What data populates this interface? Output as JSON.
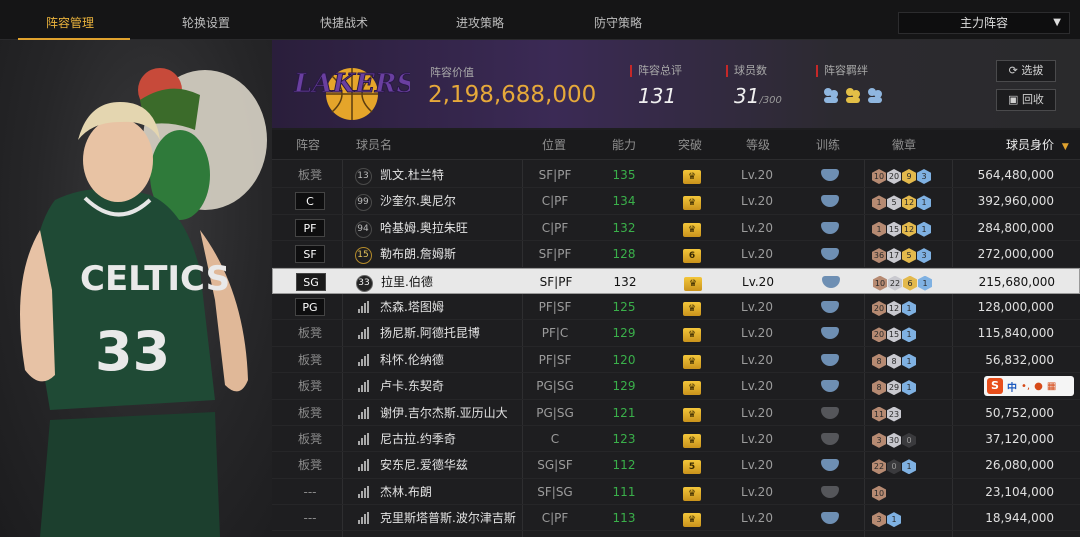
{
  "nav": {
    "tabs": [
      "阵容管理",
      "轮换设置",
      "快捷战术",
      "进攻策略",
      "防守策略"
    ],
    "active": 0,
    "lineup_select": "主力阵容"
  },
  "header": {
    "team_logo_text": "LAKERS",
    "value_label": "阵容价值",
    "value": "2,198,688,000",
    "rating_label": "阵容总评",
    "rating": "131",
    "count_label": "球员数",
    "count": "31",
    "count_max": "/300",
    "bond_label": "阵容羁绊",
    "btn_filter": "选拔",
    "btn_recycle": "回收"
  },
  "photo": {
    "jersey_text": "CELTICS",
    "jersey_number": "33"
  },
  "table": {
    "headers": {
      "pos": "阵容",
      "name": "球员名",
      "position": "位置",
      "ovr": "能力",
      "breakthrough": "突破",
      "level": "等级",
      "training": "训练",
      "badges": "徽章",
      "value": "球员身价",
      "sort": "▼"
    },
    "rows": [
      {
        "slot": "板凳",
        "key": false,
        "num": "13",
        "numStyle": "plain",
        "name": "凯文.杜兰特",
        "pos": "SF|PF",
        "ovr": "135",
        "brk": "crown",
        "lv": "Lv.20",
        "trn": "blue",
        "badges": [
          [
            "10",
            "bronze"
          ],
          [
            "20",
            "silver"
          ],
          [
            "9",
            "gold"
          ],
          [
            "3",
            "blue"
          ]
        ],
        "val": "564,480,000"
      },
      {
        "slot": "C",
        "key": true,
        "num": "99",
        "numStyle": "plain",
        "name": "沙奎尔.奥尼尔",
        "pos": "C|PF",
        "ovr": "134",
        "brk": "crown",
        "lv": "Lv.20",
        "trn": "blue",
        "badges": [
          [
            "1",
            "bronze"
          ],
          [
            "5",
            "silver"
          ],
          [
            "12",
            "gold"
          ],
          [
            "1",
            "blue"
          ]
        ],
        "val": "392,960,000"
      },
      {
        "slot": "PF",
        "key": true,
        "num": "94",
        "numStyle": "plain",
        "name": "哈基姆.奥拉朱旺",
        "pos": "C|PF",
        "ovr": "132",
        "brk": "crown",
        "lv": "Lv.20",
        "trn": "blue",
        "badges": [
          [
            "1",
            "bronze"
          ],
          [
            "15",
            "silver"
          ],
          [
            "12",
            "gold"
          ],
          [
            "1",
            "blue"
          ]
        ],
        "val": "284,800,000"
      },
      {
        "slot": "SF",
        "key": true,
        "num": "15",
        "numStyle": "gold",
        "name": "勒布朗.詹姆斯",
        "pos": "SF|PF",
        "ovr": "128",
        "brk": "6",
        "lv": "Lv.20",
        "trn": "blue",
        "badges": [
          [
            "36",
            "bronze"
          ],
          [
            "17",
            "silver"
          ],
          [
            "5",
            "gold"
          ],
          [
            "3",
            "blue"
          ]
        ],
        "val": "272,000,000"
      },
      {
        "slot": "SG",
        "key": true,
        "num": "33",
        "numStyle": "plain",
        "name": "拉里.伯德",
        "pos": "SF|PF",
        "ovr": "132",
        "brk": "crown",
        "lv": "Lv.20",
        "trn": "blue",
        "badges": [
          [
            "10",
            "bronze"
          ],
          [
            "22",
            "silver"
          ],
          [
            "6",
            "gold"
          ],
          [
            "1",
            "blue"
          ]
        ],
        "val": "215,680,000",
        "selected": true
      },
      {
        "slot": "PG",
        "key": true,
        "num": "",
        "numStyle": "bars",
        "name": "杰森.塔图姆",
        "pos": "PF|SF",
        "ovr": "125",
        "brk": "crown",
        "lv": "Lv.20",
        "trn": "blue",
        "badges": [
          [
            "20",
            "bronze"
          ],
          [
            "12",
            "silver"
          ],
          [
            "1",
            "blue"
          ]
        ],
        "val": "128,000,000"
      },
      {
        "slot": "板凳",
        "key": false,
        "num": "",
        "numStyle": "bars",
        "name": "扬尼斯.阿德托昆博",
        "pos": "PF|C",
        "ovr": "129",
        "brk": "crown",
        "lv": "Lv.20",
        "trn": "blue",
        "badges": [
          [
            "20",
            "bronze"
          ],
          [
            "15",
            "silver"
          ],
          [
            "1",
            "blue"
          ]
        ],
        "val": "115,840,000"
      },
      {
        "slot": "板凳",
        "key": false,
        "num": "",
        "numStyle": "bars",
        "name": "科怀.伦纳德",
        "pos": "PF|SF",
        "ovr": "120",
        "brk": "crown",
        "lv": "Lv.20",
        "trn": "blue",
        "badges": [
          [
            "8",
            "bronze"
          ],
          [
            "8",
            "silver"
          ],
          [
            "1",
            "blue"
          ]
        ],
        "val": "56,832,000"
      },
      {
        "slot": "板凳",
        "key": false,
        "num": "",
        "numStyle": "bars",
        "name": "卢卡.东契奇",
        "pos": "PG|SG",
        "ovr": "129",
        "brk": "crown",
        "lv": "Lv.20",
        "trn": "blue",
        "badges": [
          [
            "8",
            "bronze"
          ],
          [
            "29",
            "silver"
          ],
          [
            "1",
            "blue"
          ]
        ],
        "val": ""
      },
      {
        "slot": "板凳",
        "key": false,
        "num": "",
        "numStyle": "bars",
        "name": "谢伊.吉尔杰斯.亚历山大",
        "pos": "PG|SG",
        "ovr": "121",
        "brk": "crown",
        "lv": "Lv.20",
        "trn": "grey",
        "badges": [
          [
            "11",
            "bronze"
          ],
          [
            "23",
            "silver"
          ]
        ],
        "val": "50,752,000"
      },
      {
        "slot": "板凳",
        "key": false,
        "num": "",
        "numStyle": "bars",
        "name": "尼古拉.约季奇",
        "pos": "C",
        "ovr": "123",
        "brk": "crown",
        "lv": "Lv.20",
        "trn": "grey",
        "badges": [
          [
            "3",
            "bronze"
          ],
          [
            "30",
            "silver"
          ],
          [
            "0",
            "dark"
          ]
        ],
        "val": "37,120,000"
      },
      {
        "slot": "板凳",
        "key": false,
        "num": "",
        "numStyle": "bars",
        "name": "安东尼.爱德华兹",
        "pos": "SG|SF",
        "ovr": "112",
        "brk": "5",
        "lv": "Lv.20",
        "trn": "blue",
        "badges": [
          [
            "22",
            "bronze"
          ],
          [
            "0",
            "dark"
          ],
          [
            "1",
            "blue"
          ]
        ],
        "val": "26,080,000"
      },
      {
        "slot": "---",
        "key": false,
        "num": "",
        "numStyle": "bars",
        "name": "杰林.布朗",
        "pos": "SF|SG",
        "ovr": "111",
        "brk": "crown",
        "lv": "Lv.20",
        "trn": "grey",
        "badges": [
          [
            "10",
            "bronze"
          ]
        ],
        "val": "23,104,000"
      },
      {
        "slot": "---",
        "key": false,
        "num": "",
        "numStyle": "bars",
        "name": "克里斯塔普斯.波尔津吉斯",
        "pos": "C|PF",
        "ovr": "113",
        "brk": "crown",
        "lv": "Lv.20",
        "trn": "blue",
        "badges": [
          [
            "3",
            "bronze"
          ],
          [
            "1",
            "blue"
          ]
        ],
        "val": "18,944,000"
      }
    ]
  },
  "ime": {
    "label": "中",
    "punct": "•,"
  }
}
